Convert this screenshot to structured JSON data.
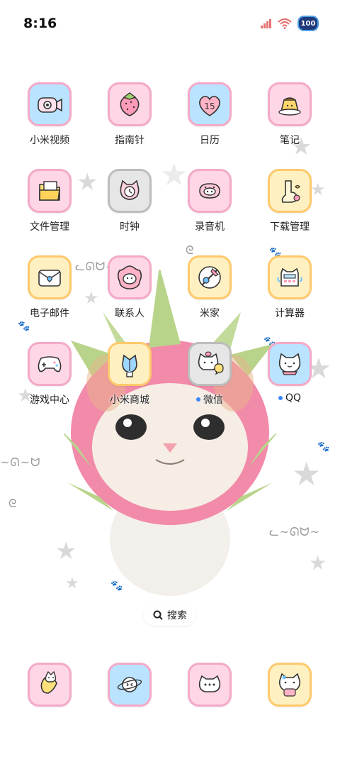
{
  "status_bar": {
    "time": "8:16",
    "battery": "100"
  },
  "apps": [
    {
      "name": "小米视频",
      "icon": "video-camera-icon"
    },
    {
      "name": "指南针",
      "icon": "strawberry-icon"
    },
    {
      "name": "日历",
      "icon": "calendar-icon",
      "badge": "15"
    },
    {
      "name": "笔记",
      "icon": "pudding-icon"
    },
    {
      "name": "文件管理",
      "icon": "folder-icon"
    },
    {
      "name": "时钟",
      "icon": "clock-icon"
    },
    {
      "name": "录音机",
      "icon": "recorder-icon"
    },
    {
      "name": "下载管理",
      "icon": "download-icon"
    },
    {
      "name": "电子邮件",
      "icon": "mail-icon"
    },
    {
      "name": "联系人",
      "icon": "contacts-icon"
    },
    {
      "name": "米家",
      "icon": "mijia-icon"
    },
    {
      "name": "计算器",
      "icon": "calculator-icon"
    },
    {
      "name": "游戏中心",
      "icon": "gamepad-icon"
    },
    {
      "name": "小米商城",
      "icon": "shop-icon"
    },
    {
      "name": "微信",
      "icon": "wechat-icon"
    },
    {
      "name": "QQ",
      "icon": "qq-icon"
    }
  ],
  "search": {
    "label": "搜索"
  },
  "dock": [
    {
      "icon": "phone-icon"
    },
    {
      "icon": "browser-icon"
    },
    {
      "icon": "messages-icon"
    },
    {
      "icon": "camera-icon"
    }
  ],
  "colors": {
    "tile_blue": "#b9e3ff",
    "tile_pink": "#ffd6e6",
    "tile_yellow": "#fff0c2",
    "new_dot": "#3a86ff"
  }
}
